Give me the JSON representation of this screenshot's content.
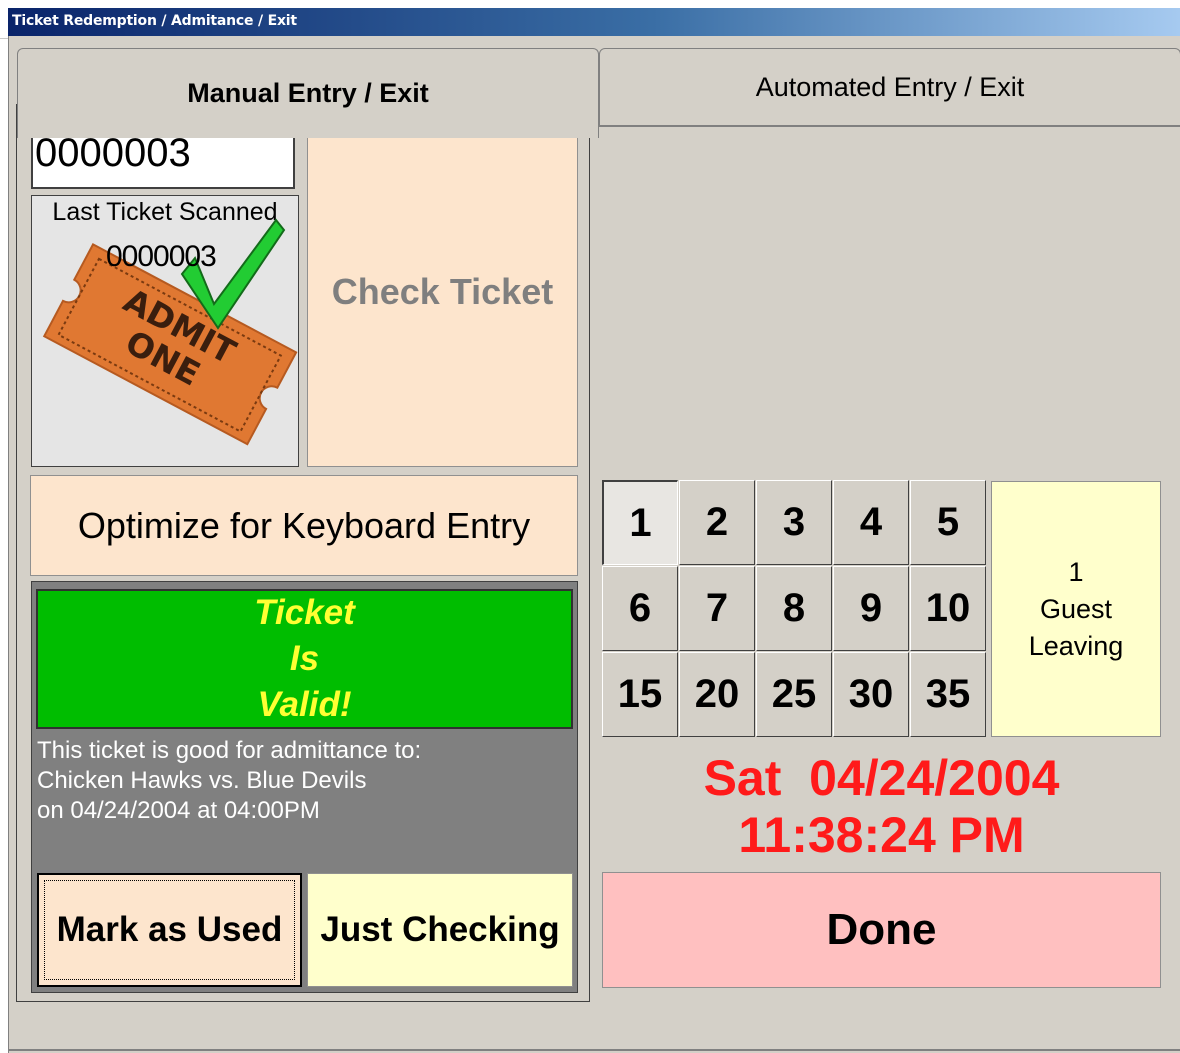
{
  "window": {
    "title": "Ticket Redemption / Admitance / Exit"
  },
  "tabs": [
    {
      "label": "Manual Entry / Exit",
      "active": true
    },
    {
      "label": "Automated Entry / Exit",
      "active": false
    }
  ],
  "manual": {
    "ticket_input_value": "0000003",
    "last_ticket": {
      "caption": "Last Ticket Scanned",
      "number": "0000003",
      "image_icon": "admit-one-ticket-icon",
      "check_icon": "green-checkmark-icon"
    },
    "check_ticket_label": "Check Ticket",
    "optimize_label": "Optimize for Keyboard Entry",
    "status": {
      "lines": [
        "Ticket",
        "Is",
        "Valid!"
      ],
      "detail": [
        "This ticket is good for admittance to:",
        "Chicken Hawks vs. Blue Devils",
        "on 04/24/2004 at 04:00PM"
      ]
    },
    "mark_used_label": "Mark as Used",
    "just_checking_label": "Just Checking"
  },
  "keypad": {
    "keys": [
      "1",
      "2",
      "3",
      "4",
      "5",
      "6",
      "7",
      "8",
      "9",
      "10",
      "15",
      "20",
      "25",
      "30",
      "35"
    ],
    "selected": "1"
  },
  "guest": {
    "count": "1",
    "line1": "Guest",
    "line2": "Leaving"
  },
  "datetime": {
    "date": "Sat  04/24/2004",
    "time": "11:38:24 PM"
  },
  "done_label": "Done",
  "colors": {
    "title_bar": "#0a246a",
    "valid_bg": "#00bd00",
    "valid_text": "#ffff33",
    "datetime_text": "#ff1a1a",
    "done_bg": "#ffc0c0",
    "peach": "#fde5cd",
    "cream": "#ffffcc"
  }
}
